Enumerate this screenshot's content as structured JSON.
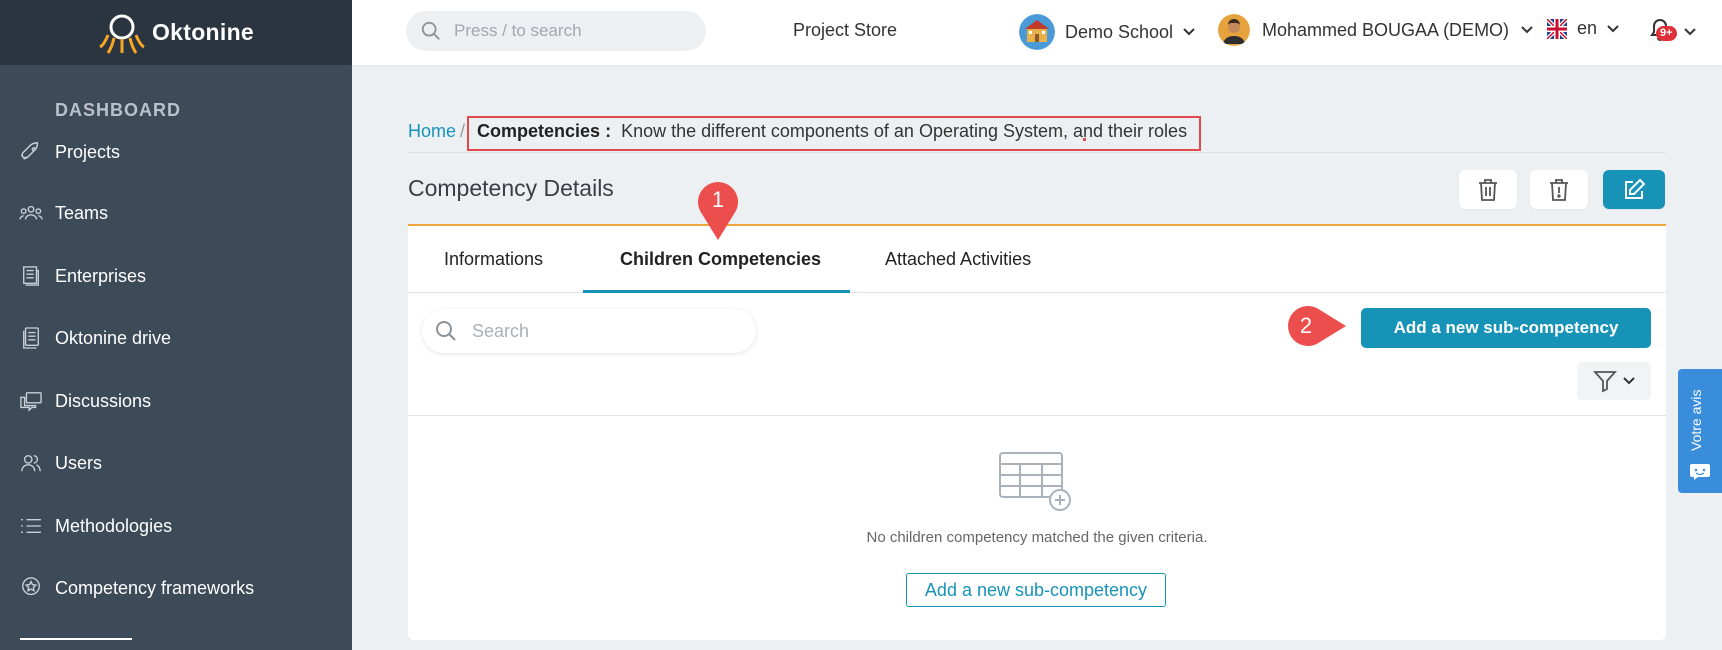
{
  "app": {
    "name": "Oktonine"
  },
  "sidebar": {
    "heading": "DASHBOARD",
    "items": [
      {
        "label": "Projects",
        "icon": "rocket-icon"
      },
      {
        "label": "Teams",
        "icon": "team-icon"
      },
      {
        "label": "Enterprises",
        "icon": "building-icon"
      },
      {
        "label": "Oktonine drive",
        "icon": "drive-icon"
      },
      {
        "label": "Discussions",
        "icon": "chat-icon"
      },
      {
        "label": "Users",
        "icon": "users-icon"
      },
      {
        "label": "Methodologies",
        "icon": "list-icon"
      },
      {
        "label": "Competency frameworks",
        "icon": "badge-icon"
      }
    ]
  },
  "topbar": {
    "search_placeholder": "Press / to search",
    "project_store": "Project Store",
    "school": "Demo School",
    "user": "Mohammed BOUGAA (DEMO)",
    "language": "en",
    "notifications_badge": "9+"
  },
  "breadcrumb": {
    "home": "Home",
    "separator": "/",
    "label": "Competencies :",
    "text": "Know the different components of an Operating System, and their roles"
  },
  "page": {
    "title": "Competency Details"
  },
  "tabs": [
    {
      "label": "Informations"
    },
    {
      "label": "Children Competencies"
    },
    {
      "label": "Attached Activities"
    }
  ],
  "content": {
    "search_placeholder": "Search",
    "add_button": "Add a new sub-competency",
    "empty_message": "No children competency matched the given criteria.",
    "add_link": "Add a new sub-competency"
  },
  "annotations": {
    "marker_1": "1",
    "marker_2": "2"
  },
  "feedback": {
    "label": "Votre avis"
  },
  "colors": {
    "accent": "#1793b8",
    "sidebar": "#3d4a58",
    "highlight": "#e04a4a",
    "card_border": "#f0a53a"
  }
}
